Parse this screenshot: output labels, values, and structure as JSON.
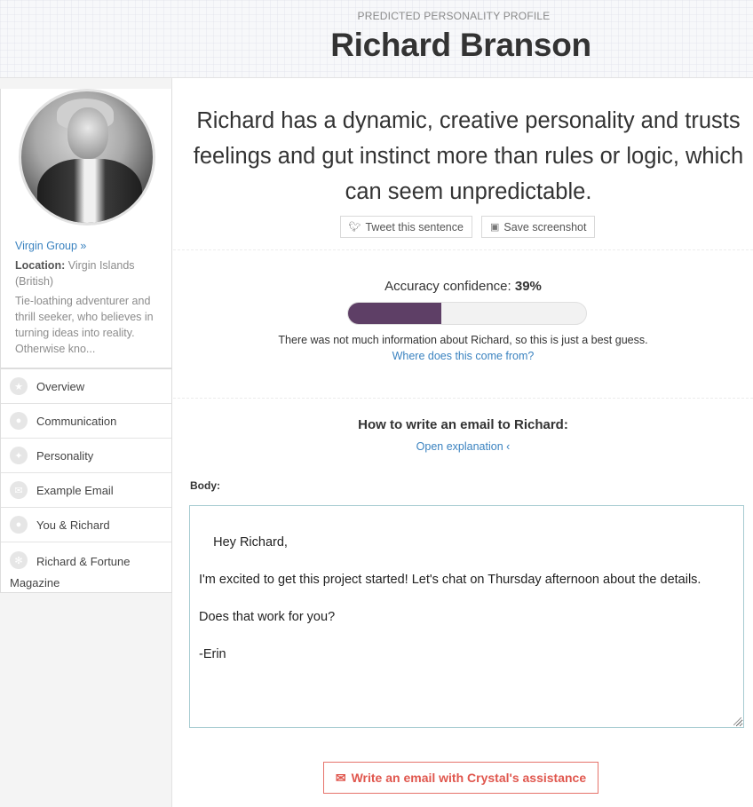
{
  "header": {
    "eyebrow": "PREDICTED PERSONALITY PROFILE",
    "name": "Richard Branson"
  },
  "sidebar": {
    "company_link": "Virgin Group »",
    "location_label": "Location:",
    "location_value": "Virgin Islands (British)",
    "bio": "Tie-loathing adventurer and thrill seeker, who believes in turning ideas into reality. Otherwise kno...",
    "nav": [
      {
        "label": "Overview",
        "icon": "star-icon"
      },
      {
        "label": "Communication",
        "icon": "chat-bubble-icon"
      },
      {
        "label": "Personality",
        "icon": "lightbulb-icon"
      },
      {
        "label": "Example Email",
        "icon": "envelope-icon"
      },
      {
        "label": "You & Richard",
        "icon": "user-icon"
      },
      {
        "label": "Richard & Fortune Magazine",
        "icon": "gear-icon"
      }
    ]
  },
  "main": {
    "summary": "Richard has a dynamic, creative personality and trusts feelings and gut instinct more than rules or logic, which can seem unpredictable.",
    "tweet_button": "Tweet this sentence",
    "screenshot_button": "Save screenshot",
    "accuracy_label": "Accuracy confidence:",
    "accuracy_value": "39%",
    "accuracy_fraction": 0.39,
    "accuracy_note": "There was not much information about Richard, so this is just a best guess.",
    "accuracy_link": "Where does this come from?",
    "email_title": "How to write an email to Richard:",
    "explanation_link": "Open explanation ‹",
    "body_label": "Body:",
    "email_body": "Hey Richard,\n\nI'm excited to get this project started! Let's chat on Thursday afternoon about the details.\n\nDoes that work for you?\n\n-Erin",
    "cta_button": "Write an email with Crystal's assistance"
  },
  "colors": {
    "accent_blue": "#3b83c0",
    "progress_fill": "#5e3f66",
    "cta_red": "#e0574e",
    "email_border": "#a7cbd1"
  }
}
